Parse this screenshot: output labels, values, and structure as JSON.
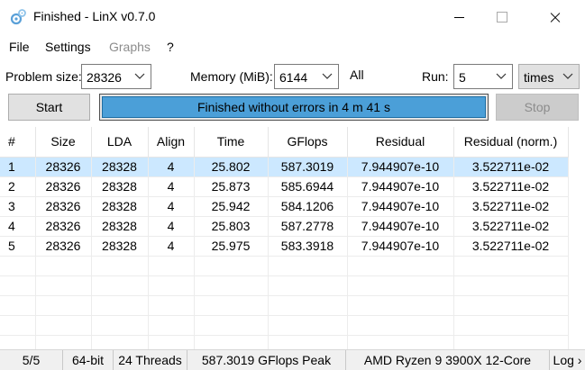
{
  "window": {
    "title": "Finished - LinX v0.7.0",
    "accent": "#4b9fd8"
  },
  "menu": {
    "file": "File",
    "settings": "Settings",
    "graphs": "Graphs",
    "help": "?"
  },
  "controls": {
    "problem_size_label": "Problem size:",
    "problem_size_value": "28326",
    "memory_label": "Memory (MiB):",
    "memory_value": "6144",
    "all_label": "All",
    "run_label": "Run:",
    "run_value": "5",
    "times_value": "times"
  },
  "actions": {
    "start": "Start",
    "stop": "Stop",
    "progress_text": "Finished without errors in 4 m 41 s",
    "progress_fraction": 1.0
  },
  "table": {
    "columns": [
      "#",
      "Size",
      "LDA",
      "Align",
      "Time",
      "GFlops",
      "Residual",
      "Residual (norm.)"
    ],
    "rows": [
      [
        "1",
        "28326",
        "28328",
        "4",
        "25.802",
        "587.3019",
        "7.944907e-10",
        "3.522711e-02"
      ],
      [
        "2",
        "28326",
        "28328",
        "4",
        "25.873",
        "585.6944",
        "7.944907e-10",
        "3.522711e-02"
      ],
      [
        "3",
        "28326",
        "28328",
        "4",
        "25.942",
        "584.1206",
        "7.944907e-10",
        "3.522711e-02"
      ],
      [
        "4",
        "28326",
        "28328",
        "4",
        "25.803",
        "587.2778",
        "7.944907e-10",
        "3.522711e-02"
      ],
      [
        "5",
        "28326",
        "28328",
        "4",
        "25.975",
        "583.3918",
        "7.944907e-10",
        "3.522711e-02"
      ]
    ],
    "selected_row": 0
  },
  "status": {
    "runs": "5/5",
    "arch": "64-bit",
    "threads": "24 Threads",
    "peak": "587.3019 GFlops Peak",
    "cpu": "AMD Ryzen 9 3900X 12-Core",
    "log": "Log ›"
  }
}
